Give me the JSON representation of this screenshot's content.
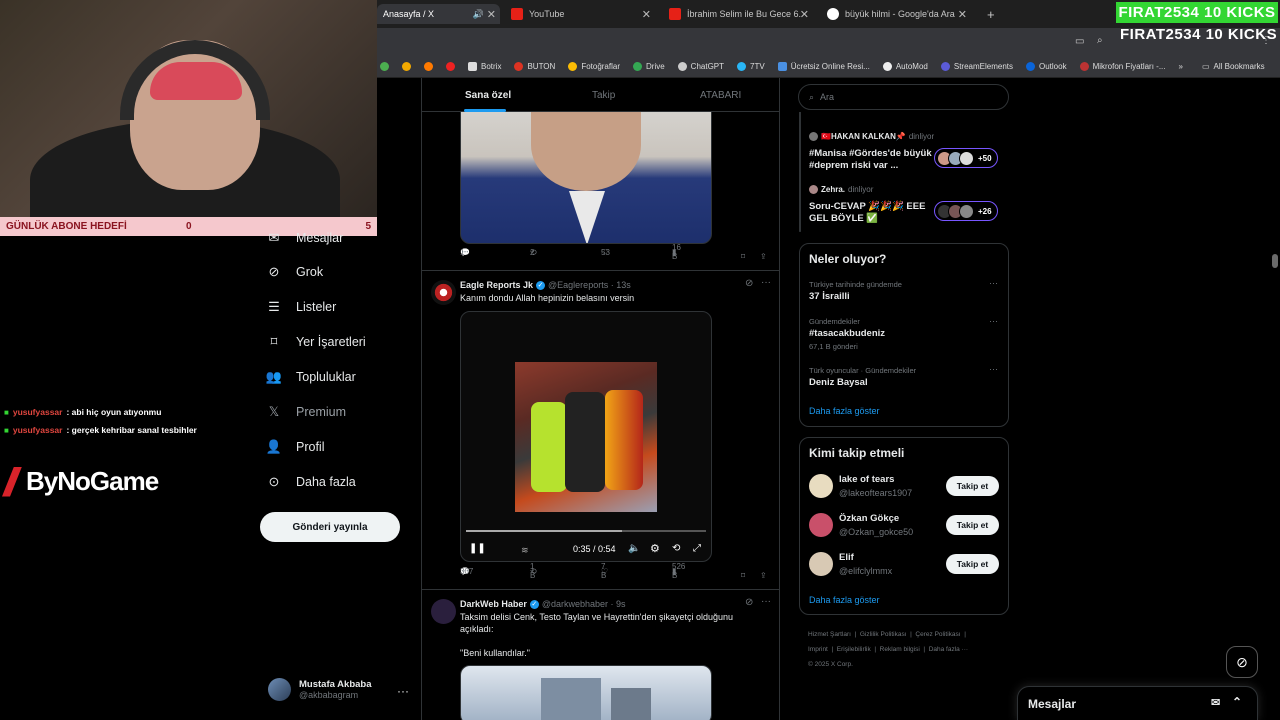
{
  "browser": {
    "tabs": [
      {
        "label": "Anasayfa / X",
        "active": true
      },
      {
        "label": "YouTube"
      },
      {
        "label": "İbrahim Selim ile Bu Gece 6. Se"
      },
      {
        "label": "büyük hilmi - Google'da Ara"
      }
    ],
    "bookmarks": [
      "Botrix",
      "BUTON",
      "Fotoğraflar",
      "Drive",
      "ChatGPT",
      "7TV",
      "Ücretsiz Online Resi...",
      "AutoMod",
      "StreamElements",
      "Outlook",
      "Mikrofon Fiyatları -..."
    ],
    "all_bookmarks": "All Bookmarks"
  },
  "stream": {
    "kicks_top": "FIRAT2534  10 KICKS",
    "kicks_bottom": "FIRAT2534  10 KICKS",
    "sub_goal_label": "GÜNLÜK ABONE HEDEFİ",
    "sub_goal_current": "0",
    "sub_goal_target": "5",
    "chat": [
      {
        "user": "yusufyassar",
        "message": ": abi hiç oyun atıyonmu"
      },
      {
        "user": "yusufyassar",
        "message": ": gerçek kehribar sanal tesbihler"
      }
    ],
    "sponsor": "ByNoGame"
  },
  "nav": {
    "items": [
      "Mesajlar",
      "Grok",
      "Listeler",
      "Yer İşaretleri",
      "Topluluklar",
      "Premium",
      "Profil",
      "Daha fazla"
    ],
    "post_button": "Gönderi yayınla",
    "profile_name": "Mustafa Akbaba",
    "profile_handle": "@akbabagram"
  },
  "timeline": {
    "tabs": [
      "Sana özel",
      "Takip",
      "ATABARI"
    ],
    "first_tweet_actions": {
      "replies": "1",
      "reposts": "2",
      "likes": "53",
      "views": "16 B"
    },
    "tweets": [
      {
        "name": "Eagle Reports Jk",
        "handle": "@Eaglereports · 13s",
        "text": "Kanım dondu Allah hepinizin belasını versin",
        "video_time": "0:35 / 0:54",
        "replies": "307",
        "reposts": "1 B",
        "likes": "7 B",
        "views": "526 B"
      },
      {
        "name": "DarkWeb Haber",
        "handle": "@darkwebhaber · 9s",
        "text": "Taksim delisi Cenk, Testo Taylan ve Hayrettin'den şikayetçi olduğunu açıkladı:",
        "quote": "\"Beni kullandılar.\""
      }
    ]
  },
  "sidebar": {
    "search_placeholder": "Ara",
    "live": [
      {
        "host": "🇹🇷HAKAN KALKAN📌",
        "status": "dinliyor",
        "title": "#Manisa #Gördes'de büyük #deprem riski var ...",
        "count": "+50"
      },
      {
        "host": "Zehra.",
        "status": "dinliyor",
        "title": "Soru-CEVAP 🎉🎉🎉 EEE GEL BÖYLE ✅",
        "count": "+26"
      }
    ],
    "whats_happening_title": "Neler oluyor?",
    "trends": [
      {
        "category": "Türkiye tarihinde gündemde",
        "name": "37 İsrailli",
        "count": ""
      },
      {
        "category": "Gündemdekiler",
        "name": "#tasacakbudeniz",
        "count": "67,1 B gönderi"
      },
      {
        "category": "Türk oyuncular · Gündemdekiler",
        "name": "Deniz Baysal",
        "count": ""
      }
    ],
    "show_more": "Daha fazla göster",
    "who_to_follow_title": "Kimi takip etmeli",
    "who": [
      {
        "name": "lake of tears",
        "handle": "@lakeoftears1907"
      },
      {
        "name": "Özkan Gökçe",
        "handle": "@Ozkan_gokce50"
      },
      {
        "name": "Elif",
        "handle": "@elifclylmmx"
      }
    ],
    "follow_label": "Takip et",
    "show_more_2": "Daha fazla göster",
    "footer": [
      "Hizmet Şartları",
      "Gizlilik Politikası",
      "Çerez Politikası",
      "Imprint",
      "Erişilebilirlik",
      "Reklam bilgisi",
      "Daha fazla ···",
      "© 2025 X Corp."
    ]
  },
  "messages": {
    "label": "Mesajlar"
  }
}
